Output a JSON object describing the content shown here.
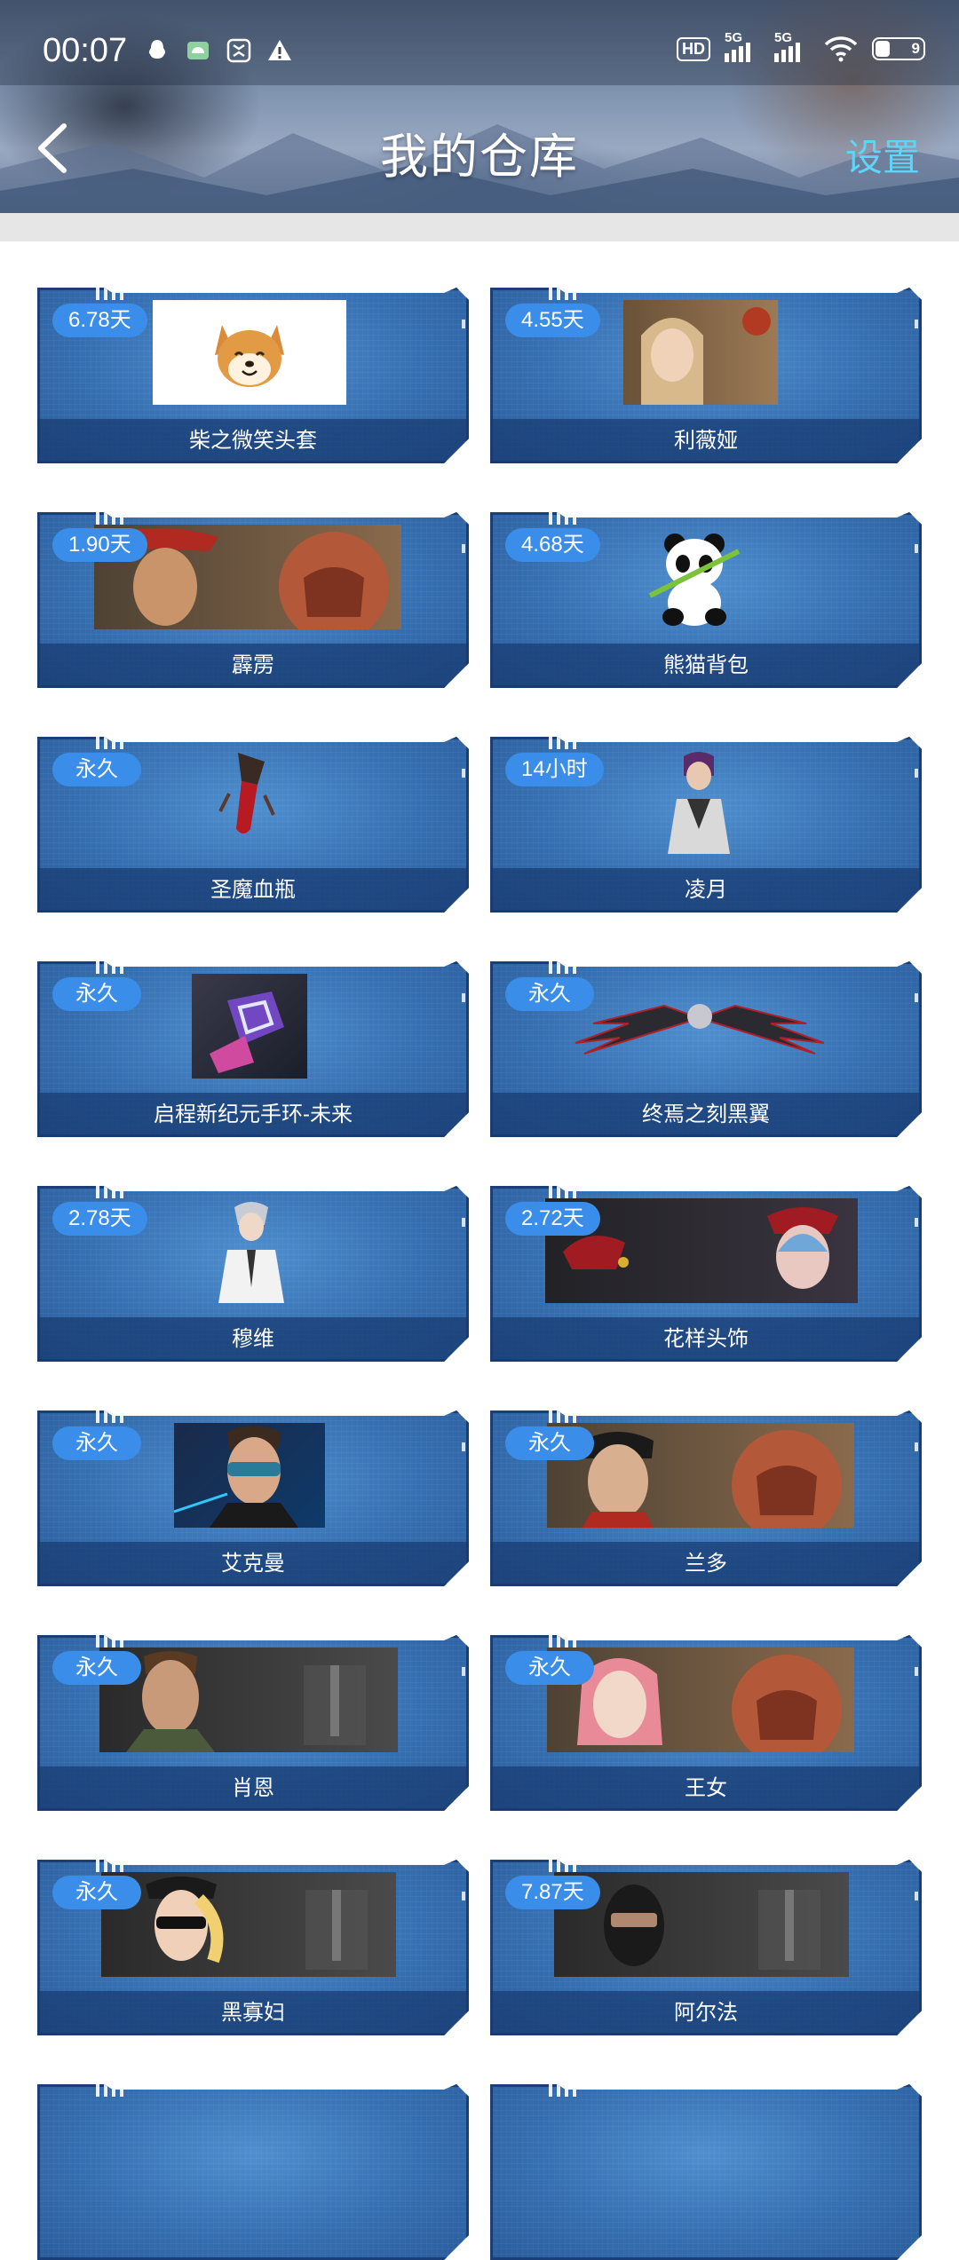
{
  "status_bar": {
    "time": "00:07",
    "hd": "HD",
    "sim1": "5G",
    "sim2": "5G",
    "battery": "9"
  },
  "header": {
    "title": "我的仓库",
    "settings_label": "设置"
  },
  "items": [
    {
      "name": "柴之微笑头套",
      "duration": "6.78天"
    },
    {
      "name": "利薇娅",
      "duration": "4.55天"
    },
    {
      "name": "霹雳",
      "duration": "1.90天"
    },
    {
      "name": "熊猫背包",
      "duration": "4.68天"
    },
    {
      "name": "圣魔血瓶",
      "duration": "永久"
    },
    {
      "name": "凌月",
      "duration": "14小时"
    },
    {
      "name": "启程新纪元手环-未来",
      "duration": "永久"
    },
    {
      "name": "终焉之刻黑翼",
      "duration": "永久"
    },
    {
      "name": "穆维",
      "duration": "2.78天"
    },
    {
      "name": "花样头饰",
      "duration": "2.72天"
    },
    {
      "name": "艾克曼",
      "duration": "永久"
    },
    {
      "name": "兰多",
      "duration": "永久"
    },
    {
      "name": "肖恩",
      "duration": "永久"
    },
    {
      "name": "王女",
      "duration": "永久"
    },
    {
      "name": "黑寡妇",
      "duration": "永久"
    },
    {
      "name": "阿尔法",
      "duration": "7.87天"
    }
  ],
  "colors": {
    "badge": "#3a8de8",
    "card": "#3670b2",
    "settings": "#5ed4f6"
  }
}
